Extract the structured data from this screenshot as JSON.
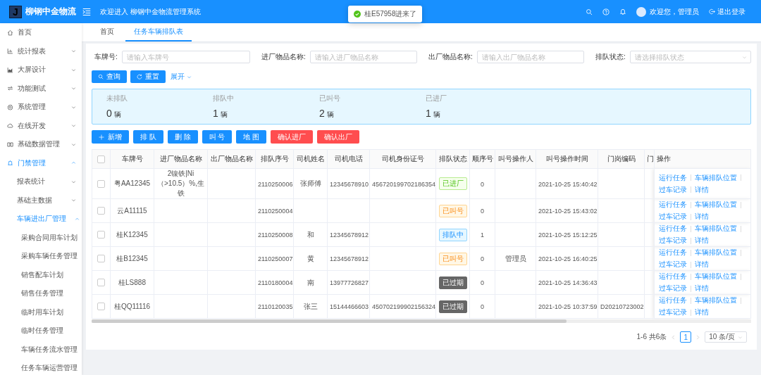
{
  "header": {
    "logo_letter": "J",
    "brand": "柳钢中金物流",
    "welcome": "欢迎进入 柳钢中金物流管理系统",
    "user_greeting": "欢迎您，管理员",
    "logout": "退出登录"
  },
  "toast": {
    "message": "桂E57958进来了"
  },
  "sidebar": {
    "items": [
      {
        "kind": "link",
        "label": "首页",
        "selected": false
      },
      {
        "kind": "group",
        "label": "统计报表",
        "expanded": false,
        "selected": false
      },
      {
        "kind": "group",
        "label": "大屏设计",
        "expanded": false,
        "selected": false
      },
      {
        "kind": "group",
        "label": "功能测试",
        "expanded": false,
        "selected": false
      },
      {
        "kind": "group",
        "label": "系统管理",
        "expanded": false,
        "selected": false
      },
      {
        "kind": "group",
        "label": "在线开发",
        "expanded": false,
        "selected": false
      },
      {
        "kind": "group",
        "label": "基础数据管理",
        "expanded": false,
        "selected": false
      },
      {
        "kind": "group",
        "label": "门禁管理",
        "expanded": true,
        "selected": true,
        "children": [
          {
            "kind": "group",
            "label": "报表统计",
            "expanded": false,
            "selected": false
          },
          {
            "kind": "group",
            "label": "基础主数据",
            "expanded": false,
            "selected": false
          },
          {
            "kind": "group",
            "label": "车辆进出厂管理",
            "expanded": true,
            "selected": true,
            "children": [
              {
                "kind": "link",
                "label": "采购合同用车计划",
                "selected": false
              },
              {
                "kind": "link",
                "label": "采购车辆任务管理",
                "selected": false
              },
              {
                "kind": "link",
                "label": "销售配车计划",
                "selected": false
              },
              {
                "kind": "link",
                "label": "销售任务管理",
                "selected": false
              },
              {
                "kind": "link",
                "label": "临时用车计划",
                "selected": false
              },
              {
                "kind": "link",
                "label": "临时任务管理",
                "selected": false
              },
              {
                "kind": "link",
                "label": "车辆任务流水管理",
                "selected": false
              },
              {
                "kind": "link",
                "label": "任务车辆运营管理",
                "selected": false
              }
            ]
          }
        ]
      }
    ]
  },
  "tabs": [
    {
      "label": "首页",
      "selected": false
    },
    {
      "label": "任务车辆排队表",
      "selected": true
    }
  ],
  "filters": [
    {
      "kind": "input",
      "label": "车牌号:",
      "placeholder": "请输入车牌号"
    },
    {
      "kind": "input",
      "label": "进厂物品名称:",
      "placeholder": "请输入进厂物品名称"
    },
    {
      "kind": "input",
      "label": "出厂物品名称:",
      "placeholder": "请输入出厂物品名称"
    },
    {
      "kind": "select",
      "label": "排队状态:",
      "placeholder": "请选择排队状态"
    }
  ],
  "search_buttons": [
    {
      "kind": "search",
      "label": "查询"
    },
    {
      "kind": "reset",
      "label": "重置"
    }
  ],
  "expand_toggle": "展开",
  "stats": [
    {
      "label": "未排队",
      "value": "0",
      "unit": "辆"
    },
    {
      "label": "排队中",
      "value": "1",
      "unit": "辆"
    },
    {
      "label": "已叫号",
      "value": "2",
      "unit": "辆"
    },
    {
      "label": "已进厂",
      "value": "1",
      "unit": "辆"
    }
  ],
  "actions": [
    {
      "kind": "add",
      "label": "新增"
    },
    {
      "kind": "primary",
      "label": "排 队"
    },
    {
      "kind": "primary",
      "label": "删 除"
    },
    {
      "kind": "primary",
      "label": "叫 号"
    },
    {
      "kind": "primary",
      "label": "地 图"
    },
    {
      "kind": "danger",
      "label": "确认进厂"
    },
    {
      "kind": "danger",
      "label": "确认出厂"
    }
  ],
  "table": {
    "select_all": {
      "checked": false
    },
    "columns": [
      "车牌号",
      "进厂物品名称",
      "出厂物品名称",
      "排队序号",
      "司机姓名",
      "司机电话",
      "司机身份证号",
      "排队状态",
      "顺序号",
      "叫号操作人",
      "叫号操作时间",
      "门岗编码",
      "门",
      "操作"
    ],
    "rows": [
      {
        "checked": false,
        "plate": "粤AA12345",
        "inbound_item": "2镍铁|Ni（>10.5）%,生铁",
        "queue_no": "2110250006",
        "driver": "张师傅",
        "phone": "12345678910",
        "id_no": "456720199702186354",
        "status": {
          "kind": "entered",
          "label": "已进厂"
        },
        "order": "0",
        "call_time": "2021-10-25 15:40:42",
        "actions": [
          "运行任务",
          "车辆排队位置",
          "过车记录",
          "详情"
        ]
      },
      {
        "checked": false,
        "plate": "云A11115",
        "queue_no": "2110250004",
        "status": {
          "kind": "called",
          "label": "已叫号"
        },
        "order": "0",
        "call_time": "2021-10-25 15:43:02",
        "actions": [
          "运行任务",
          "车辆排队位置",
          "过车记录",
          "详情"
        ]
      },
      {
        "checked": false,
        "plate": "桂K12345",
        "queue_no": "2110250008",
        "driver": "和",
        "phone": "12345678912",
        "status": {
          "kind": "queuing",
          "label": "排队中"
        },
        "order": "1",
        "call_time": "2021-10-25 15:12:25",
        "actions": [
          "运行任务",
          "车辆排队位置",
          "过车记录",
          "详情"
        ]
      },
      {
        "checked": false,
        "plate": "桂B12345",
        "queue_no": "2110250007",
        "driver": "黄",
        "phone": "12345678912",
        "status": {
          "kind": "called",
          "label": "已叫号"
        },
        "order": "0",
        "caller": "管理员",
        "call_time": "2021-10-25 16:40:25",
        "actions": [
          "运行任务",
          "车辆排队位置",
          "过车记录",
          "详情"
        ]
      },
      {
        "checked": false,
        "plate": "桂LS888",
        "queue_no": "2110180004",
        "driver": "南",
        "phone": "13977726827",
        "status": {
          "kind": "expired",
          "label": "已过期"
        },
        "order": "0",
        "call_time": "2021-10-25 14:36:43",
        "actions": [
          "运行任务",
          "车辆排队位置",
          "过车记录",
          "详情"
        ]
      },
      {
        "checked": false,
        "plate": "桂QQ11116",
        "queue_no": "2110120035",
        "driver": "张三",
        "phone": "15144466603",
        "id_no": "450702199902156324",
        "status": {
          "kind": "expired",
          "label": "已过期"
        },
        "order": "0",
        "call_time": "2021-10-25 10:37:59",
        "gate_code": "D20210723002",
        "actions": [
          "运行任务",
          "车辆排队位置",
          "过车记录",
          "详情"
        ]
      }
    ]
  },
  "pagination": {
    "summary": "1-6 共6条",
    "pages": [
      {
        "label": "1",
        "selected": true
      }
    ],
    "page_size": "10 条/页"
  }
}
